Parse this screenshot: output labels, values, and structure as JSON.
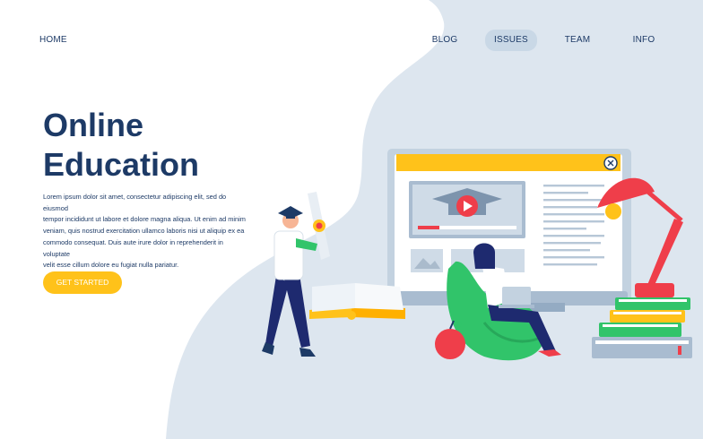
{
  "nav": {
    "home": "HOME",
    "blog": "BLOG",
    "issues": "ISSUES",
    "team": "TEAM",
    "info": "INFO"
  },
  "hero": {
    "title_line1": "Online",
    "title_line2": "Education",
    "body_line1": "Lorem ipsum dolor sit amet, consectetur adipiscing elit, sed do eiusmod",
    "body_line2": "tempor incididunt ut labore et dolore magna aliqua. Ut enim ad minim",
    "body_line3": "veniam, quis nostrud exercitation ullamco laboris nisi ut aliquip ex ea",
    "body_line4": "commodo consequat. Duis aute irure dolor in reprehenderit in voluptate",
    "body_line5": "velit esse cillum dolore eu fugiat nulla pariatur.",
    "cta_label": "GET STARTED"
  },
  "colors": {
    "navy": "#1d3a66",
    "accent_yellow": "#ffc21a",
    "blob": "#dde6ef",
    "nav_active_pill": "#c9d8e6",
    "lamp_red": "#ef3e4a",
    "green": "#31c46a"
  },
  "illustration": {
    "icons": [
      "video-play-icon",
      "close-icon",
      "graduation-cap-icon",
      "image-placeholder-icon",
      "award-medal-icon"
    ]
  }
}
